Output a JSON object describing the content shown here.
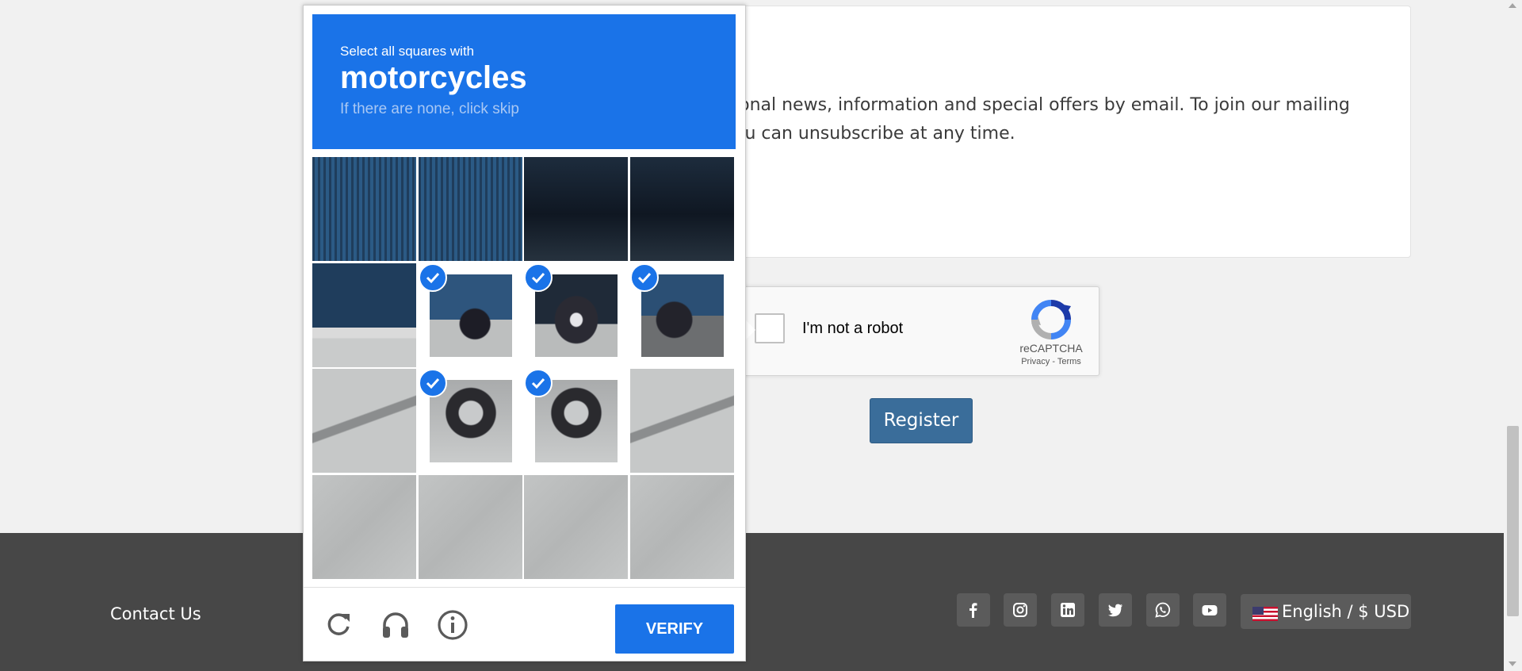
{
  "page": {
    "newsletter_line1": "ional news, information and special offers by email. To join our mailing",
    "newsletter_line2": "ou can unsubscribe at any time."
  },
  "recaptcha": {
    "label": "I'm not a robot",
    "brand": "reCAPTCHA",
    "links": "Privacy - Terms",
    "colors": {
      "blue": "#1c3aa9",
      "light_blue": "#4285f4",
      "grey": "#b0b0b0"
    }
  },
  "register": {
    "label": "Register",
    "color": "#3a6d9a"
  },
  "footer": {
    "contact_label": "Contact Us",
    "social_icons": [
      "facebook-icon",
      "instagram-icon",
      "linkedin-icon",
      "twitter-icon",
      "whatsapp-icon",
      "youtube-icon"
    ],
    "language_label": "English / $ USD"
  },
  "challenge": {
    "instruction": "Select all squares with",
    "object": "motorcycles",
    "skip_hint": "If there are none, click skip",
    "accent_color": "#1a73e8",
    "grid_size": 4,
    "selected_tiles": [
      5,
      6,
      7,
      9,
      10
    ],
    "tile_scenes": [
      "blue-wall-grille",
      "blue-wall-grille",
      "dark-doorway",
      "dark-doorway",
      "wall-curb",
      "motorcycle-front",
      "motorcycle-engine",
      "motorcycle-rear",
      "pavement-shadow",
      "motorcycle-wheel",
      "motorcycle-wheel",
      "pavement-shadow",
      "pavement",
      "pavement",
      "pavement",
      "pavement"
    ],
    "footer_icons": [
      "reload-icon",
      "audio-icon",
      "info-icon"
    ],
    "verify_label": "VERIFY"
  }
}
